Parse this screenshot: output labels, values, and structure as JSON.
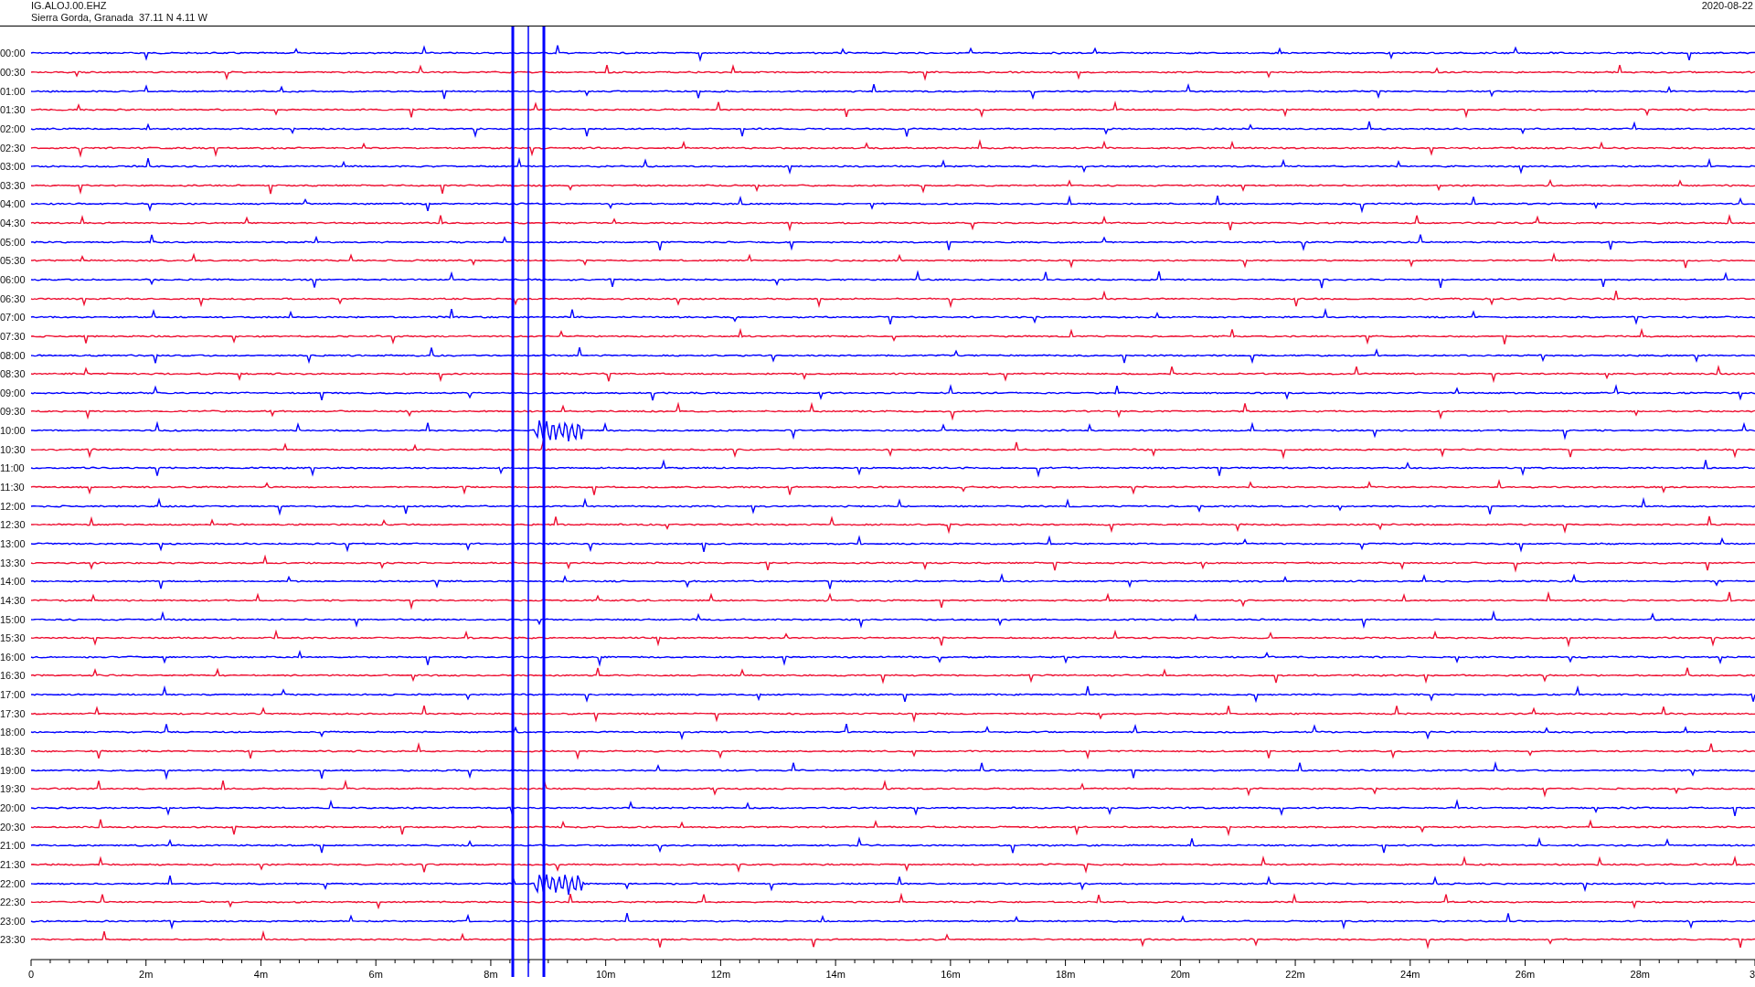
{
  "header": {
    "station": "IG.ALOJ.00.EHZ",
    "location": "Sierra Gorda, Granada  37.11 N 4.11 W",
    "date": "2020-08-22"
  },
  "rows": [
    {
      "time": "00:00",
      "color": "#0000ff",
      "event": false
    },
    {
      "time": "00:30",
      "color": "#ee1133",
      "event": false
    },
    {
      "time": "01:00",
      "color": "#0000ff",
      "event": false
    },
    {
      "time": "01:30",
      "color": "#ee1133",
      "event": false
    },
    {
      "time": "02:00",
      "color": "#0000ff",
      "event": false
    },
    {
      "time": "02:30",
      "color": "#ee1133",
      "event": false
    },
    {
      "time": "03:00",
      "color": "#0000ff",
      "event": false
    },
    {
      "time": "03:30",
      "color": "#ee1133",
      "event": false
    },
    {
      "time": "04:00",
      "color": "#0000ff",
      "event": false
    },
    {
      "time": "04:30",
      "color": "#ee1133",
      "event": false
    },
    {
      "time": "05:00",
      "color": "#0000ff",
      "event": false
    },
    {
      "time": "05:30",
      "color": "#ee1133",
      "event": false
    },
    {
      "time": "06:00",
      "color": "#0000ff",
      "event": false
    },
    {
      "time": "06:30",
      "color": "#ee1133",
      "event": false
    },
    {
      "time": "07:00",
      "color": "#0000ff",
      "event": false
    },
    {
      "time": "07:30",
      "color": "#ee1133",
      "event": false
    },
    {
      "time": "08:00",
      "color": "#0000ff",
      "event": false
    },
    {
      "time": "08:30",
      "color": "#ee1133",
      "event": false
    },
    {
      "time": "09:00",
      "color": "#0000ff",
      "event": false
    },
    {
      "time": "09:30",
      "color": "#ee1133",
      "event": false
    },
    {
      "time": "10:00",
      "color": "#0000ff",
      "event": true
    },
    {
      "time": "10:30",
      "color": "#ee1133",
      "event": false
    },
    {
      "time": "11:00",
      "color": "#0000ff",
      "event": false
    },
    {
      "time": "11:30",
      "color": "#ee1133",
      "event": false
    },
    {
      "time": "12:00",
      "color": "#0000ff",
      "event": false
    },
    {
      "time": "12:30",
      "color": "#ee1133",
      "event": false
    },
    {
      "time": "13:00",
      "color": "#0000ff",
      "event": false
    },
    {
      "time": "13:30",
      "color": "#ee1133",
      "event": false
    },
    {
      "time": "14:00",
      "color": "#0000ff",
      "event": false
    },
    {
      "time": "14:30",
      "color": "#ee1133",
      "event": false
    },
    {
      "time": "15:00",
      "color": "#0000ff",
      "event": false
    },
    {
      "time": "15:30",
      "color": "#ee1133",
      "event": false
    },
    {
      "time": "16:00",
      "color": "#0000ff",
      "event": false
    },
    {
      "time": "16:30",
      "color": "#ee1133",
      "event": false
    },
    {
      "time": "17:00",
      "color": "#0000ff",
      "event": false
    },
    {
      "time": "17:30",
      "color": "#ee1133",
      "event": false
    },
    {
      "time": "18:00",
      "color": "#0000ff",
      "event": false
    },
    {
      "time": "18:30",
      "color": "#ee1133",
      "event": false
    },
    {
      "time": "19:00",
      "color": "#0000ff",
      "event": false
    },
    {
      "time": "19:30",
      "color": "#ee1133",
      "event": false
    },
    {
      "time": "20:00",
      "color": "#0000ff",
      "event": false
    },
    {
      "time": "20:30",
      "color": "#ee1133",
      "event": false
    },
    {
      "time": "21:00",
      "color": "#0000ff",
      "event": false
    },
    {
      "time": "21:30",
      "color": "#ee1133",
      "event": false
    },
    {
      "time": "22:00",
      "color": "#0000ff",
      "event": true
    },
    {
      "time": "22:30",
      "color": "#ee1133",
      "event": false
    },
    {
      "time": "23:00",
      "color": "#0000ff",
      "event": false
    },
    {
      "time": "23:30",
      "color": "#ee1133",
      "event": false
    }
  ],
  "x_axis": {
    "labels": [
      "0",
      "2m",
      "4m",
      "6m",
      "8m",
      "10m",
      "12m",
      "14m",
      "16m",
      "18m",
      "20m",
      "22m",
      "24m",
      "26m",
      "28m",
      "3"
    ]
  }
}
